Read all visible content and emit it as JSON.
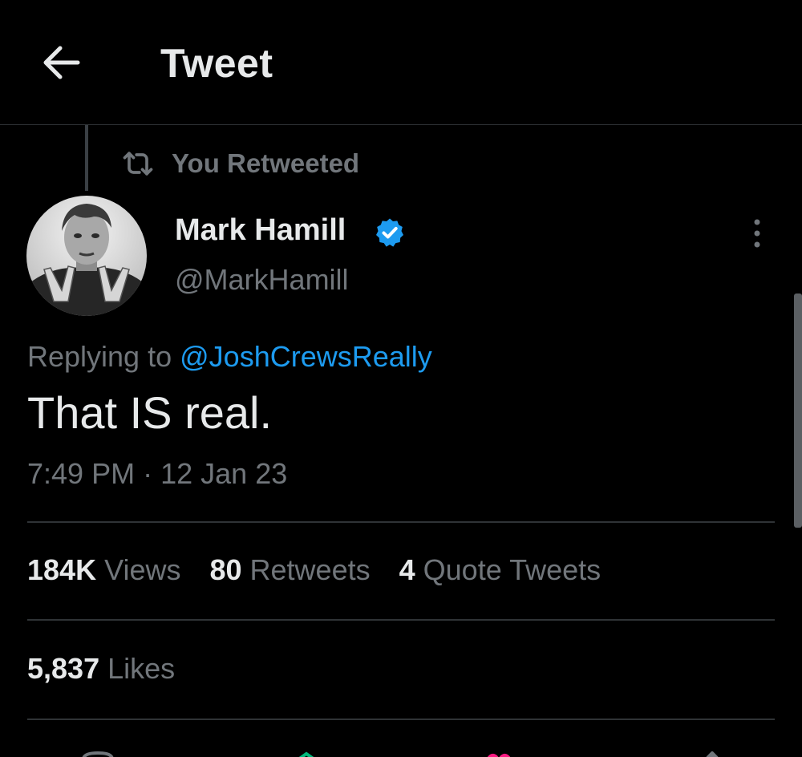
{
  "header": {
    "title": "Tweet",
    "back_icon": "arrow-left-icon"
  },
  "retweet": {
    "label": "You Retweeted",
    "icon": "retweet-icon"
  },
  "author": {
    "name": "Mark Hamill",
    "handle": "@MarkHamill",
    "verified": true,
    "verified_color": "#1d9bf0"
  },
  "tweet": {
    "replying_prefix": "Replying to",
    "replying_to": "@JoshCrewsReally",
    "text": "That IS real.",
    "time": "7:49 PM",
    "separator": "·",
    "date": "12 Jan 23"
  },
  "stats": {
    "views_count": "184K",
    "views_label": "Views",
    "retweets_count": "80",
    "retweets_label": "Retweets",
    "quotes_count": "4",
    "quotes_label": "Quote Tweets",
    "likes_count": "5,837",
    "likes_label": "Likes"
  },
  "colors": {
    "background": "#000000",
    "text_primary": "#e7e9ea",
    "text_secondary": "#71767b",
    "link": "#1d9bf0",
    "divider": "#2f3336"
  }
}
